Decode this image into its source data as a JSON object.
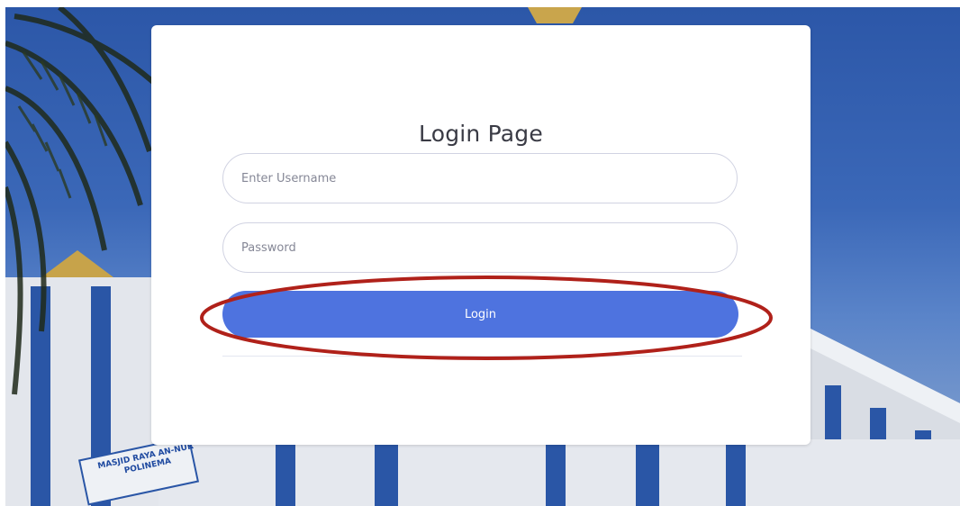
{
  "page": {
    "title": "Login Page"
  },
  "form": {
    "username_placeholder": "Enter Username",
    "password_placeholder": "Password",
    "login_label": "Login"
  },
  "background": {
    "sign_line1": "MASJID RAYA AN-NUR",
    "sign_line2": "POLINEMA"
  },
  "colors": {
    "primary": "#4e73df",
    "annotation": "#b0211a",
    "sky": "#2f5aa8"
  }
}
